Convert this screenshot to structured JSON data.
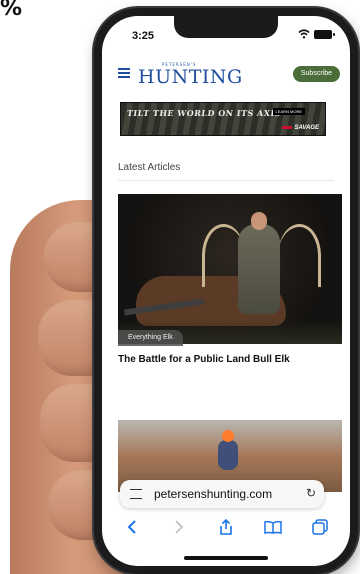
{
  "corner_text": "%",
  "status": {
    "time": "3:25"
  },
  "header": {
    "logo_top": "PETERSEN'S",
    "logo_main": "HUNTING",
    "subscribe_label": "Subscribe"
  },
  "ad": {
    "headline": "TILT THE WORLD ON ITS AXIS",
    "cta": "LEARN MORE",
    "brand": "SAVAGE"
  },
  "section_title": "Latest Articles",
  "articles": [
    {
      "tag": "Everything Elk",
      "title": "The Battle for a Public Land Bull Elk"
    }
  ],
  "browser": {
    "url": "petersenshunting.com",
    "reload_glyph": "↻"
  },
  "colors": {
    "brand_blue": "#1f4f9a",
    "subscribe_green": "#4a6d3a",
    "safari_blue": "#1a73e8"
  }
}
